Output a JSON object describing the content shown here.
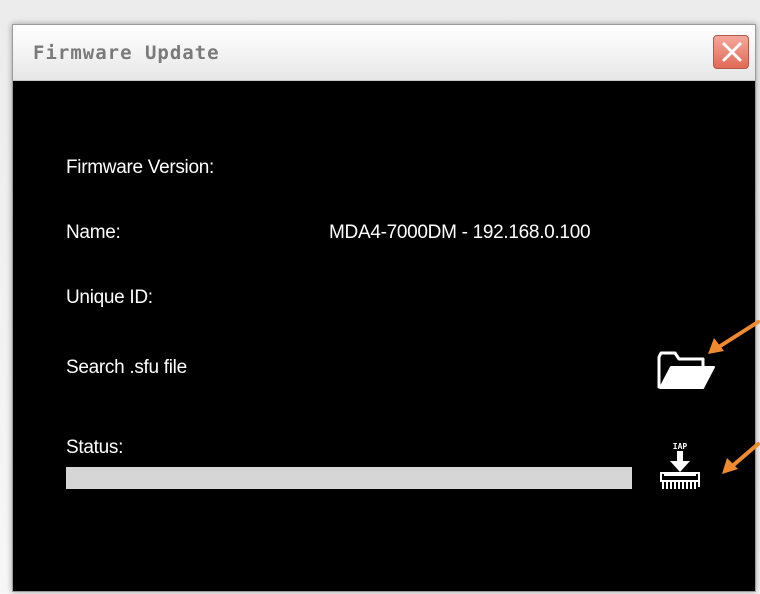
{
  "window": {
    "title": "Firmware Update"
  },
  "fields": {
    "firmware_version_label": "Firmware Version:",
    "firmware_version_value": "",
    "name_label": "Name:",
    "name_value": "MDA4-7000DM - 192.168.0.100",
    "unique_id_label": "Unique ID:",
    "unique_id_value": "",
    "search_label": "Search .sfu file",
    "status_label": "Status:"
  },
  "progress": {
    "value": 0
  },
  "icons": {
    "folder": "open-folder-icon",
    "program": "iap-chip-program-icon",
    "close": "close-icon"
  },
  "colors": {
    "window_bg": "#000000",
    "text": "#ffffff",
    "progress_track": "#d6d6d6",
    "annotation_arrow": "#f08a30",
    "close_button": "#e06a55"
  }
}
